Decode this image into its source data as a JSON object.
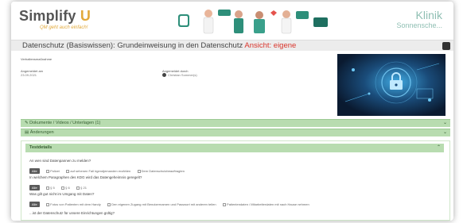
{
  "header": {
    "logo_text": "Simplify",
    "logo_u": "U",
    "slogan": "QM geht auch einfach!",
    "clinic_name": "Klinik",
    "clinic_sub": "Sonnensche..."
  },
  "page": {
    "title": "Datenschutz (Basiswissen): Grundeinweisung in den Datenschutz",
    "view_label": "Ansicht: eigene"
  },
  "meta": {
    "category_label": "Verhaltensmaßnahme",
    "created_label": "Angemeldet am",
    "created_value": "23.09.2021",
    "author_label": "Angemeldet durch",
    "author_value": "Christian Sommer(s)"
  },
  "accordions": {
    "documents": "Dokumente / Videos / Unterlagen (1)",
    "changes": "Änderungen",
    "testdetails": "Testdetails"
  },
  "questions": [
    {
      "text": "An wen sind Datenpannen zu melden?",
      "all_label": "Alle",
      "options": [
        "Polizei",
        "auf sehenen Fall irgendjemanden erzählen",
        "Dem Datenschutzbeauftragten"
      ]
    },
    {
      "text": "In welchem Paragraphen des KDG wird das Datengeheimnis geregelt?",
      "all_label": "Alle",
      "options": [
        "§ 5",
        "§ 6",
        "§ 21"
      ]
    },
    {
      "text": "Was gilt gut nicht im Umgang mit Daten?",
      "all_label": "Alle",
      "options": [
        "Fotos von Patienten mit dem Handy",
        "Den eigenen Zugang mit Benutzernamen und Passwort mit anderen teilen",
        "Patientendaten / Mitarbeiterdaten mit nach Hause nehmen"
      ]
    },
    {
      "text": "...ist der Datenschutz für unsere Einrichtungen gültig?",
      "all_label": "",
      "options": []
    }
  ],
  "colors": {
    "accordion_bg": "#b8dcb0",
    "view_red": "#d9342b",
    "logo_accent": "#e2a93a",
    "clinic_text": "#8fbfb3"
  }
}
